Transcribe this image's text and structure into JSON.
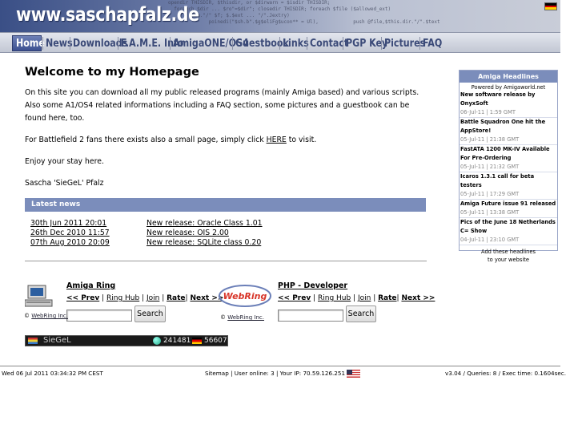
{
  "header": {
    "site_title": "www.saschapfalz.de",
    "code_background": "opendir THISDIR, $thisdir, or $dirwarn = $isdir THISDIR;\n  foreach $dir ... $ro\"=$dir\"; closedir THISDIR; foreach $file ($allowed_ext)\n        $th.\"/\" $f; $.$ext ... \"/\".Jextry)\n              poinedi(\"$sh.b\".$g$eliFg$ucon** = Ul),            push @file,$this.dir.\"/\".$text",
    "flag_colors": [
      "#000000",
      "#dd0000",
      "#ffce00"
    ]
  },
  "nav": {
    "items": [
      "Home",
      "News",
      "Downloads",
      "F.A.M.E. Info",
      "AmigaONE/OS4",
      "Guestbook",
      "Links",
      "Contact",
      "PGP Key",
      "Pictures",
      "FAQ"
    ],
    "active": "Home"
  },
  "main": {
    "title": "Welcome to my Homepage",
    "intro": "On this site you can download all my public released programs (mainly Amiga based) and various scripts. Also some A1/OS4 related informations including a FAQ section, some pictures and a guestbook can be found here, too.",
    "bf2_before": "For Battlefield 2 fans there exists also a small page, simply click ",
    "bf2_link": "HERE",
    "bf2_after": " to visit.",
    "enjoy": "Enjoy your stay here.",
    "signature": "Sascha 'SieGeL' Pfalz"
  },
  "news": {
    "header": "Latest news",
    "rows": [
      {
        "date": "30th Jun 2011 20:01",
        "title": "New release: Oracle Class 1.01"
      },
      {
        "date": "26th Dec 2010 11:57",
        "title": "New release: OIS 2.00"
      },
      {
        "date": "07th Aug 2010 20:09",
        "title": "New release: SQLite class 0.20"
      }
    ]
  },
  "rings": [
    {
      "name": "Amiga Ring",
      "prev": "<< Prev",
      "hub": "Ring Hub",
      "join": "Join",
      "rate": "Rate",
      "next": "Next >>",
      "copyright": "©",
      "webring": "WebRing Inc.",
      "search": "Search"
    },
    {
      "name": "PHP - Developer",
      "prev": "<< Prev",
      "hub": "Ring Hub",
      "join": "Join",
      "rate": "Rate",
      "next": "Next >>",
      "copyright": "©",
      "webring": "WebRing Inc.",
      "search": "Search",
      "logo": "WebRing"
    }
  ],
  "counter": {
    "name": "SieGeL",
    "visits": "241481",
    "local": "56607"
  },
  "footer": {
    "datetime": "Wed 06 Jul 2011 03:34:32 PM CEST",
    "sitemap": "Sitemap",
    "users": "User online: 3",
    "ip": "Your IP: 70.59.126.251",
    "stats": "v3.04 / Queries: 8 / Exec time: 0.1604sec."
  },
  "sidebar": {
    "title": "Amiga Headlines",
    "powered": "Powered by Amigaworld.net",
    "items": [
      {
        "title": "New software release by OnyxSoft",
        "date": "06-Jul-11 | 1:59 GMT"
      },
      {
        "title": "Battle Squadron One hit the AppStore!",
        "date": "05-Jul-11 | 21:38 GMT"
      },
      {
        "title": "FastATA 1200 MK-IV Available For Pre-Ordering",
        "date": "05-Jul-11 | 21:32 GMT"
      },
      {
        "title": "Icaros 1.3.1 call for beta testers",
        "date": "05-Jul-11 | 17:29 GMT"
      },
      {
        "title": "Amiga Future issue 91 released",
        "date": "05-Jul-11 | 13:38 GMT"
      },
      {
        "title": "Pics of the June 18 Netherlands C= Show",
        "date": "04-Jul-11 | 23:10 GMT"
      }
    ],
    "add_line1": "Add these headlines",
    "add_line2": "to your website"
  },
  "colors": {
    "accent": "#7b8dbb",
    "nav_text": "#3b4a78",
    "header_dark": "#3a4f86"
  }
}
